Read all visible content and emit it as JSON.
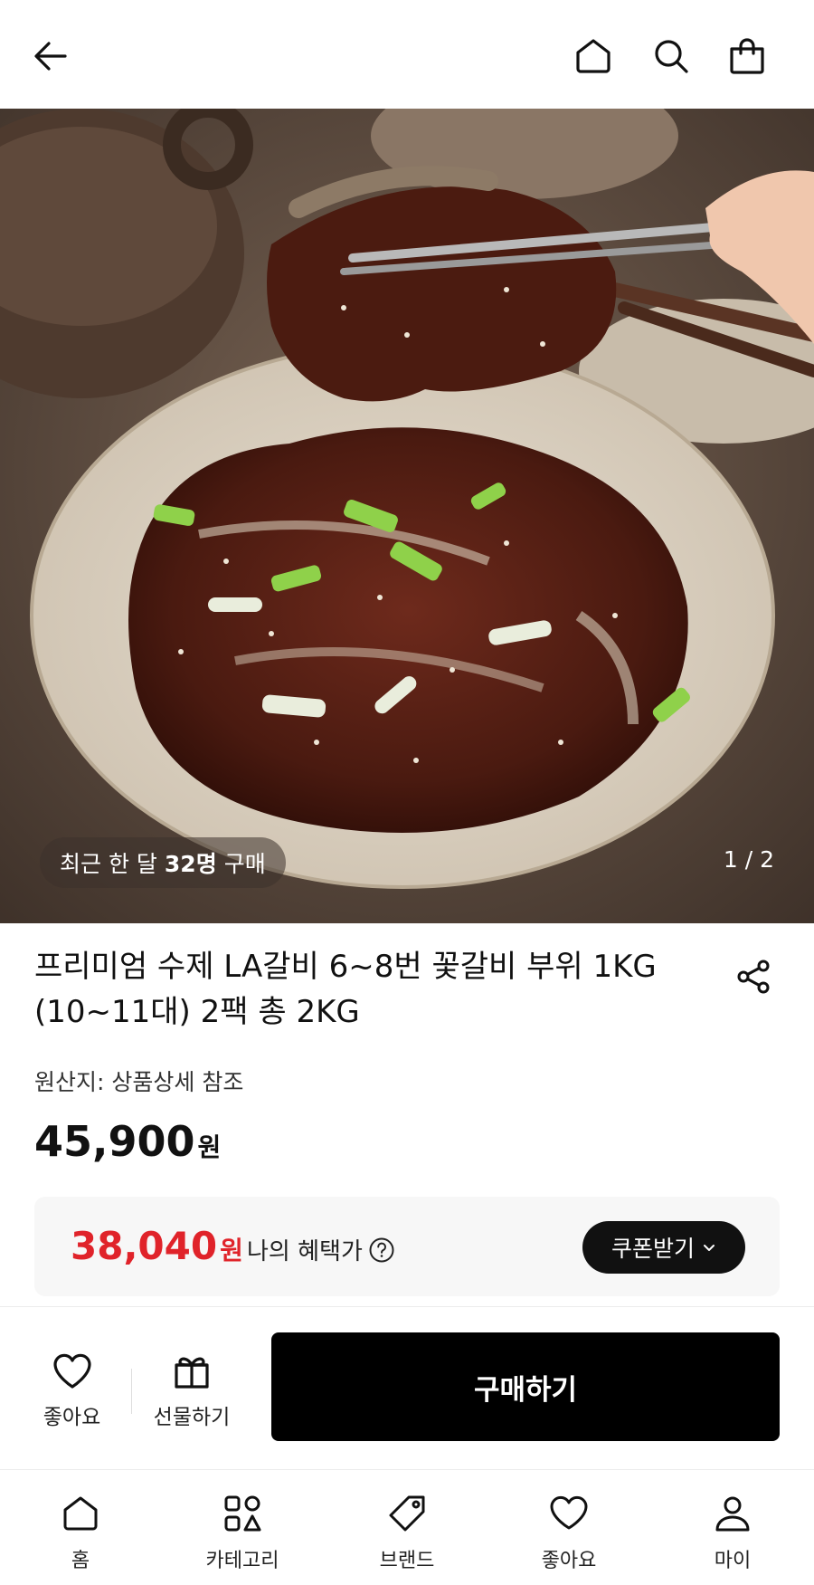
{
  "header": {
    "back_icon": "arrow-left-icon",
    "home_icon": "home-icon",
    "search_icon": "search-icon",
    "cart_icon": "shopping-bag-icon"
  },
  "hero": {
    "recent_prefix": "최근 한 달",
    "recent_count": "32명",
    "recent_suffix": "구매",
    "page_indicator": "1 / 2"
  },
  "product": {
    "title": "프리미엄 수제 LA갈비 6~8번 꽃갈비 부위 1KG (10~11대) 2팩 총 2KG",
    "origin": "원산지: 상품상세 참조",
    "price": "45,900",
    "price_unit": "원",
    "share_icon": "share-icon"
  },
  "benefit": {
    "price": "38,040",
    "price_unit": "원",
    "label": "나의 혜택가",
    "help_icon": "question-icon",
    "coupon_label": "쿠폰받기",
    "accent_color": "#e0232a"
  },
  "buybar": {
    "like_label": "좋아요",
    "gift_label": "선물하기",
    "buy_label": "구매하기"
  },
  "tabbar": {
    "items": [
      {
        "label": "홈",
        "icon": "home-icon"
      },
      {
        "label": "카테고리",
        "icon": "category-icon"
      },
      {
        "label": "브랜드",
        "icon": "tag-icon"
      },
      {
        "label": "좋아요",
        "icon": "heart-icon"
      },
      {
        "label": "마이",
        "icon": "user-icon"
      }
    ]
  }
}
